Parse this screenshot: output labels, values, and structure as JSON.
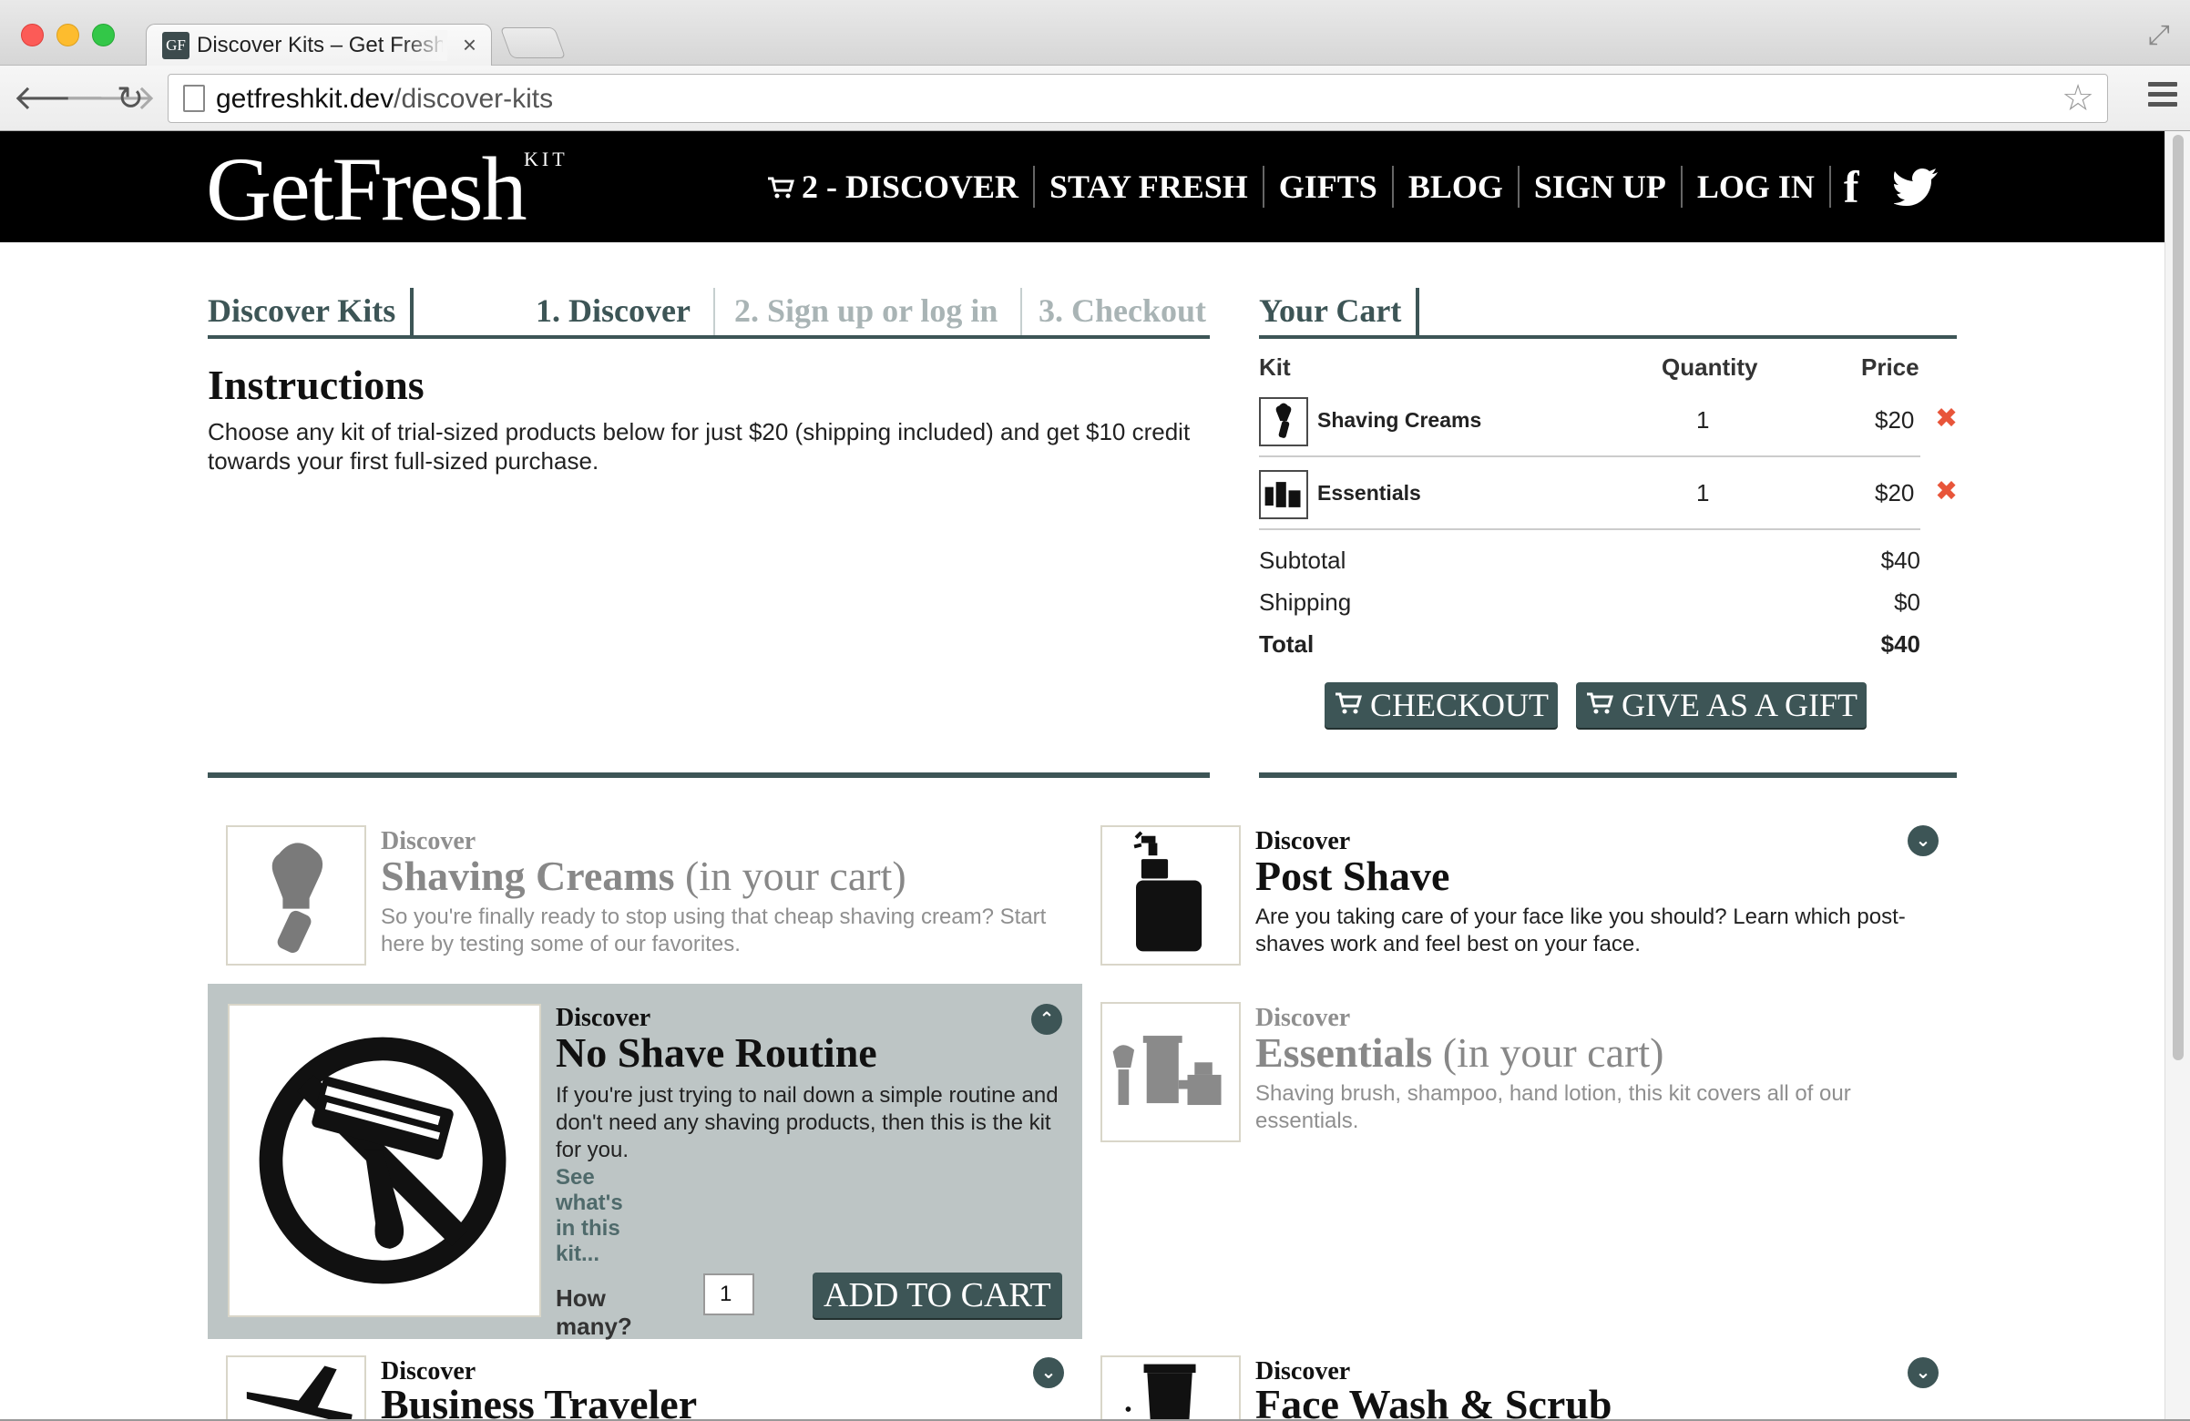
{
  "browser": {
    "tab_title": "Discover Kits – Get Fresh Kit",
    "tab_favicon_text": "GF",
    "url_host": "getfreshkit.dev",
    "url_path": "/discover-kits"
  },
  "header": {
    "logo": "GetFresh",
    "logo_kit": "KIT",
    "nav": {
      "discover": "2 - DISCOVER",
      "stay_fresh": "STAY FRESH",
      "gifts": "GIFTS",
      "blog": "BLOG",
      "sign_up": "SIGN UP",
      "log_in": "LOG IN",
      "facebook": "f"
    }
  },
  "steps": {
    "title": "Discover Kits",
    "step1": "1. Discover",
    "step2": "2. Sign up or log in",
    "step3": "3. Checkout"
  },
  "instructions": {
    "title": "Instructions",
    "text": "Choose any kit of trial-sized products below for just $20 (shipping included) and get $10 credit towards your first full-sized purchase."
  },
  "cart": {
    "title": "Your Cart",
    "col_kit": "Kit",
    "col_qty": "Quantity",
    "col_price": "Price",
    "items": [
      {
        "name": "Shaving Creams",
        "qty": "1",
        "price": "$20",
        "remove": "✖"
      },
      {
        "name": "Essentials",
        "qty": "1",
        "price": "$20",
        "remove": "✖"
      }
    ],
    "subtotal_label": "Subtotal",
    "subtotal": "$40",
    "shipping_label": "Shipping",
    "shipping": "$0",
    "total_label": "Total",
    "total": "$40",
    "checkout": "CHECKOUT",
    "gift": "GIVE AS A GIFT"
  },
  "kits": {
    "shaving": {
      "eyebrow": "Discover",
      "title": "Shaving Creams",
      "incart": "(in your cart)",
      "desc": "So you're finally ready to stop using that cheap shaving cream? Start here by testing some of our favorites."
    },
    "post_shave": {
      "eyebrow": "Discover",
      "title": "Post Shave",
      "desc": "Are you taking care of your face like you should? Learn which post-shaves work and feel best on your face.",
      "toggle": "⌄"
    },
    "no_shave": {
      "eyebrow": "Discover",
      "title": "No Shave Routine",
      "desc": "If you're just trying to nail down a simple routine and don't need any shaving products, then this is the kit for you.",
      "link": "See what's in this kit...",
      "how_many": "How many?",
      "qty": "1",
      "add": "ADD TO CART",
      "toggle": "⌃"
    },
    "essentials": {
      "eyebrow": "Discover",
      "title": "Essentials",
      "incart": "(in your cart)",
      "desc": "Shaving brush, shampoo, hand lotion, this kit covers all of our essentials."
    },
    "business": {
      "eyebrow": "Discover",
      "title": "Business Traveler",
      "toggle": "⌄"
    },
    "face_wash": {
      "eyebrow": "Discover",
      "title": "Face Wash & Scrub",
      "toggle": "⌄"
    }
  },
  "colors": {
    "brand": "#3d5556",
    "remove": "#e8553a",
    "expanded_bg": "#bdc5c5"
  }
}
